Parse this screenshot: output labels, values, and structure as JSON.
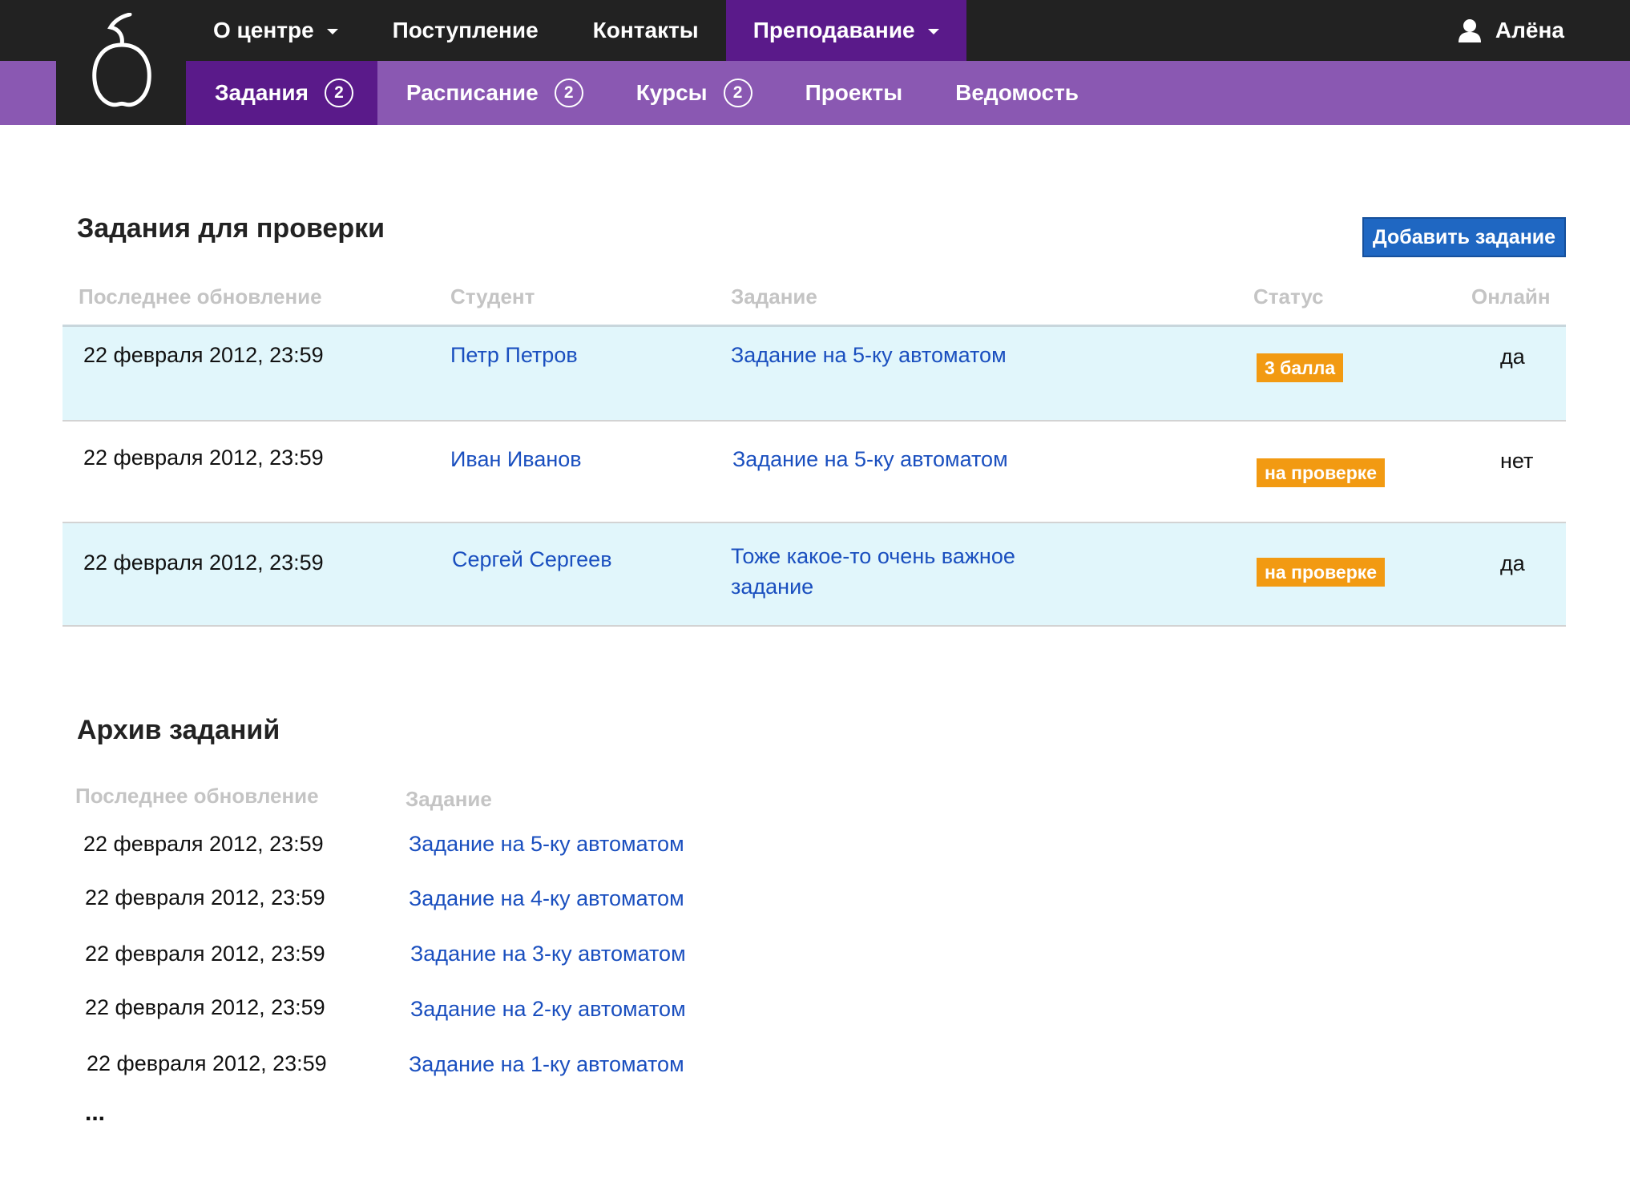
{
  "logo": {
    "icon": "apple-logo-icon"
  },
  "top_nav": [
    {
      "label": "О центре",
      "dropdown": true,
      "active": false
    },
    {
      "label": "Поступление",
      "dropdown": false,
      "active": false
    },
    {
      "label": "Контакты",
      "dropdown": false,
      "active": false
    },
    {
      "label": "Преподавание",
      "dropdown": true,
      "active": true
    }
  ],
  "user": {
    "name": "Алёна",
    "icon": "user-icon"
  },
  "sub_nav": [
    {
      "label": "Задания",
      "badge": "2",
      "active": true
    },
    {
      "label": "Расписание",
      "badge": "2",
      "active": false
    },
    {
      "label": "Курсы",
      "badge": "2",
      "active": false
    },
    {
      "label": "Проекты",
      "badge": null,
      "active": false
    },
    {
      "label": "Ведомость",
      "badge": null,
      "active": false
    }
  ],
  "review": {
    "title": "Задания для проверки",
    "add_button": "Добавить задание",
    "headers": {
      "updated": "Последнее обновление",
      "student": "Студент",
      "task": "Задание",
      "status": "Статус",
      "online": "Онлайн"
    },
    "rows": [
      {
        "updated": "22 февраля 2012, 23:59",
        "student": "Петр Петров",
        "task": "Задание на 5-ку автоматом",
        "task_line2": "",
        "status": "3 балла",
        "online": "да"
      },
      {
        "updated": "22 февраля 2012, 23:59",
        "student": "Иван Иванов",
        "task": "Задание на 5-ку автоматом",
        "task_line2": "",
        "status": "на проверке",
        "online": "нет"
      },
      {
        "updated": "22 февраля 2012, 23:59",
        "student": "Сергей Сергеев",
        "task": "Тоже какое-то очень важное",
        "task_line2": "задание",
        "status": "на проверке",
        "online": "да"
      }
    ]
  },
  "archive": {
    "title": "Архив заданий",
    "headers": {
      "updated": "Последнее обновление",
      "task": "Задание"
    },
    "rows": [
      {
        "updated": "22 февраля 2012, 23:59",
        "task": "Задание на 5-ку автоматом"
      },
      {
        "updated": "22 февраля 2012, 23:59",
        "task": "Задание на 4-ку автоматом"
      },
      {
        "updated": "22 февраля 2012, 23:59",
        "task": "Задание на 3-ку автоматом"
      },
      {
        "updated": "22 февраля 2012, 23:59",
        "task": "Задание на 2-ку автоматом"
      },
      {
        "updated": "22 февраля 2012, 23:59",
        "task": "Задание на 1-ку автоматом"
      }
    ],
    "more": "..."
  },
  "colors": {
    "topbar": "#222222",
    "subbar": "#8a58b2",
    "active_nav": "#5a1a8a",
    "link": "#1a4fbf",
    "status_badge": "#f29a12",
    "row_tint": "#e1f6fb",
    "button": "#1f67c2"
  }
}
